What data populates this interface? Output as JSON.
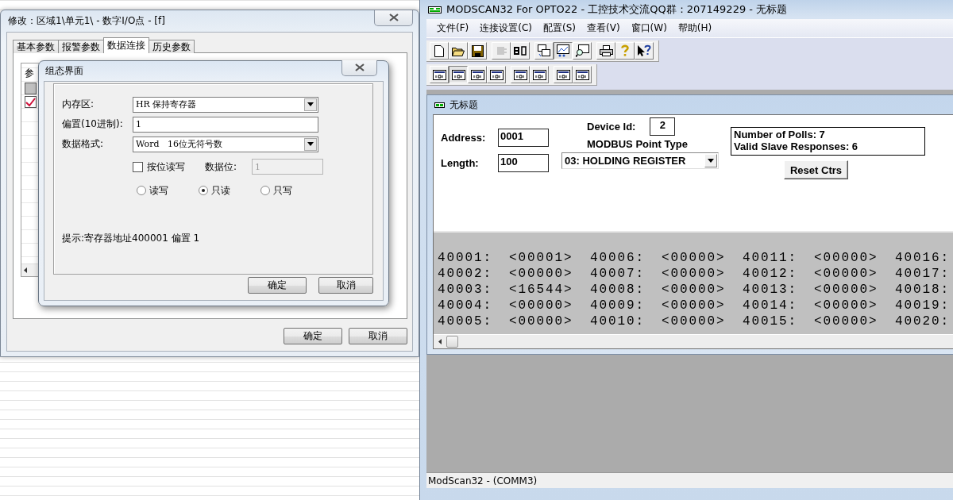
{
  "config_window": {
    "title": "修改：区域1\\单元1\\ - 数字I/O点 - [f]",
    "tabs": [
      {
        "label": "基本参数",
        "selected": false
      },
      {
        "label": "报警参数",
        "selected": false
      },
      {
        "label": "数据连接",
        "selected": true
      },
      {
        "label": "历史参数",
        "selected": false
      }
    ],
    "params_list": {
      "header": "参",
      "items": [
        {
          "checked": false
        },
        {
          "checked": true
        }
      ]
    },
    "buttons": [
      "确定",
      "取消"
    ]
  },
  "config_dialog": {
    "title": "组态界面",
    "fields": [
      {
        "kind": "select",
        "label": "内存区:",
        "value": "HR 保持寄存器"
      },
      {
        "kind": "input",
        "label": "偏置(10进制):",
        "value": "1"
      },
      {
        "kind": "select",
        "label": "数据格式:",
        "value": "Word   16位无符号数"
      }
    ],
    "bit_access": {
      "label": "按位读写",
      "checked": false,
      "bit_label": "数据位:",
      "bit_value": "1",
      "bit_disabled": true
    },
    "access_modes": [
      {
        "label": "读写",
        "selected": false
      },
      {
        "label": "只读",
        "selected": true
      },
      {
        "label": "只写",
        "selected": false
      }
    ],
    "hint": "提示:寄存器地址400001 偏置 1",
    "buttons": [
      "确定",
      "取消"
    ]
  },
  "modscan_window": {
    "title": "MODSCAN32 For OPTO22 - 工控技术交流QQ群：207149229 - 无标题",
    "menu": [
      "文件(F)",
      "连接设置(C)",
      "配置(S)",
      "查看(V)",
      "窗口(W)",
      "帮助(H)"
    ],
    "toolbars": [
      [
        [
          {
            "kind": "new",
            "pressed": false,
            "disabled": false
          },
          {
            "kind": "open",
            "pressed": false,
            "disabled": false
          },
          {
            "kind": "save",
            "pressed": false,
            "disabled": false
          }
        ],
        [
          {
            "kind": "connect",
            "pressed": false,
            "disabled": true
          },
          {
            "kind": "disconnect",
            "pressed": false,
            "disabled": false
          }
        ],
        [
          {
            "kind": "windows",
            "pressed": false,
            "disabled": false
          },
          {
            "kind": "display",
            "pressed": true,
            "disabled": false
          },
          {
            "kind": "monitor",
            "pressed": false,
            "disabled": false
          }
        ],
        [
          {
            "kind": "print",
            "pressed": false,
            "disabled": false
          },
          {
            "kind": "help",
            "pressed": false,
            "disabled": false
          },
          {
            "kind": "context-help",
            "pressed": false,
            "disabled": false
          }
        ]
      ],
      [
        [
          {
            "kind": "format",
            "pressed": false,
            "disabled": false
          },
          {
            "kind": "format",
            "pressed": true,
            "disabled": false
          },
          {
            "kind": "format",
            "pressed": false,
            "disabled": false
          },
          {
            "kind": "format",
            "pressed": false,
            "disabled": false
          }
        ],
        [
          {
            "kind": "format",
            "pressed": false,
            "disabled": false
          },
          {
            "kind": "format",
            "pressed": false,
            "disabled": false
          }
        ],
        [
          {
            "kind": "format",
            "pressed": false,
            "disabled": false
          },
          {
            "kind": "format",
            "pressed": false,
            "disabled": false
          }
        ]
      ]
    ],
    "document": {
      "title": "无标题",
      "address_label": "Address:",
      "address": "0001",
      "length_label": "Length:",
      "length": "100",
      "device_id_label": "Device Id:",
      "device_id": "2",
      "point_type_label": "MODBUS Point Type",
      "point_type": "03: HOLDING REGISTER",
      "polls": "Number of Polls: 7",
      "responses": "Valid Slave Responses: 6",
      "reset_button": "Reset Ctrs",
      "registers": [
        [
          {
            "address": "40001:",
            "value": "<00001>"
          },
          {
            "address": "40002:",
            "value": "<00000>"
          },
          {
            "address": "40003:",
            "value": "<16544>"
          },
          {
            "address": "40004:",
            "value": "<00000>"
          },
          {
            "address": "40005:",
            "value": "<00000>"
          }
        ],
        [
          {
            "address": "40006:",
            "value": "<00000>"
          },
          {
            "address": "40007:",
            "value": "<00000>"
          },
          {
            "address": "40008:",
            "value": "<00000>"
          },
          {
            "address": "40009:",
            "value": "<00000>"
          },
          {
            "address": "40010:",
            "value": "<00000>"
          }
        ],
        [
          {
            "address": "40011:",
            "value": "<00000>"
          },
          {
            "address": "40012:",
            "value": "<00000>"
          },
          {
            "address": "40013:",
            "value": "<00000>"
          },
          {
            "address": "40014:",
            "value": "<00000>"
          },
          {
            "address": "40015:",
            "value": "<00000>"
          }
        ],
        [
          {
            "address": "40016:"
          },
          {
            "address": "40017:"
          },
          {
            "address": "40018:"
          },
          {
            "address": "40019:"
          },
          {
            "address": "40020:"
          }
        ]
      ]
    },
    "status_bar": "ModScan32 - (COMM3)"
  }
}
